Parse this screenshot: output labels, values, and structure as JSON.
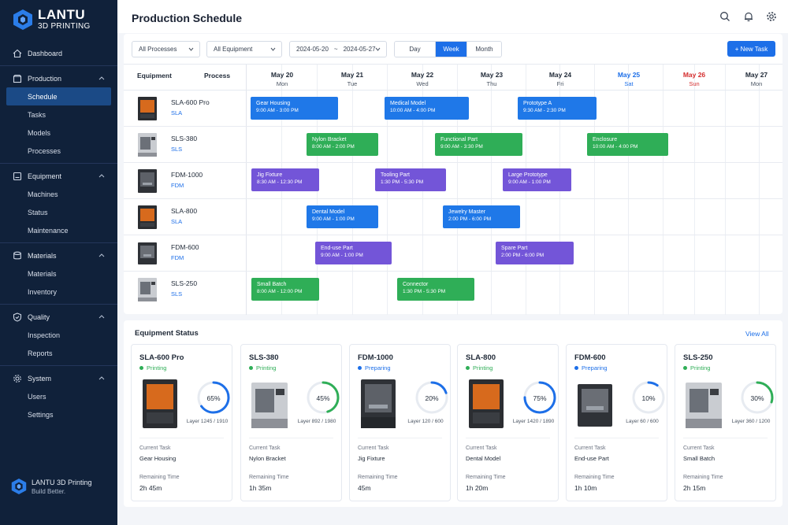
{
  "brand": {
    "name": "LANTU",
    "sub": "3D PRINTING"
  },
  "nav": {
    "dashboard": "Dashboard",
    "production": "Production",
    "schedule": "Schedule",
    "tasks": "Tasks",
    "models": "Models",
    "processes": "Processes",
    "equipment": "Equipment",
    "machines": "Machines",
    "status": "Status",
    "maintenance": "Maintenance",
    "materials": "Materials",
    "materials_sub": "Materials",
    "inventory": "Inventory",
    "quality": "Quality",
    "inspection": "Inspection",
    "reports": "Reports",
    "system": "System",
    "users": "Users",
    "settings": "Settings"
  },
  "footer": {
    "name": "LANTU 3D Printing",
    "tagline": "Build Better."
  },
  "header": {
    "title": "Production Schedule"
  },
  "filters": {
    "process": "All Processes",
    "equipment": "All Equipment",
    "date_from": "2024-05-20",
    "date_sep": "~",
    "date_to": "2024-05-27",
    "view_day": "Day",
    "view_week": "Week",
    "view_month": "Month",
    "new_task": "+ New Task"
  },
  "grid": {
    "col_equipment": "Equipment",
    "col_process": "Process",
    "days": [
      {
        "date": "May 20",
        "weekday": "Mon"
      },
      {
        "date": "May 21",
        "weekday": "Tue"
      },
      {
        "date": "May 22",
        "weekday": "Wed"
      },
      {
        "date": "May 23",
        "weekday": "Thu"
      },
      {
        "date": "May 24",
        "weekday": "Fri"
      },
      {
        "date": "May 25",
        "weekday": "Sat"
      },
      {
        "date": "May 26",
        "weekday": "Sun"
      },
      {
        "date": "May 27",
        "weekday": "Mon"
      }
    ],
    "rows": [
      {
        "name": "SLA-600 Pro",
        "process": "SLA",
        "tasks": [
          {
            "name": "Gear Housing",
            "time": "9:00 AM - 3:00 PM"
          },
          {
            "name": "Medical Model",
            "time": "10:00 AM - 4:00 PM"
          },
          {
            "name": "Prototype A",
            "time": "9:30 AM - 2:30 PM"
          }
        ]
      },
      {
        "name": "SLS-380",
        "process": "SLS",
        "tasks": [
          {
            "name": "Nylon Bracket",
            "time": "8:00 AM - 2:00 PM"
          },
          {
            "name": "Functional Part",
            "time": "9:00 AM - 3:30 PM"
          },
          {
            "name": "Enclosure",
            "time": "10:00 AM - 4:00 PM"
          }
        ]
      },
      {
        "name": "FDM-1000",
        "process": "FDM",
        "tasks": [
          {
            "name": "Jig Fixture",
            "time": "8:30 AM - 12:30 PM"
          },
          {
            "name": "Tooling Part",
            "time": "1:30 PM - 5:30 PM"
          },
          {
            "name": "Large Prototype",
            "time": "9:00 AM - 1:00 PM"
          }
        ]
      },
      {
        "name": "SLA-800",
        "process": "SLA",
        "tasks": [
          {
            "name": "Dental Model",
            "time": "9:00 AM - 1:00 PM"
          },
          {
            "name": "Jewelry Master",
            "time": "2:00 PM - 6:00 PM"
          }
        ]
      },
      {
        "name": "FDM-600",
        "process": "FDM",
        "tasks": [
          {
            "name": "End-use Part",
            "time": "9:00 AM - 1:00 PM"
          },
          {
            "name": "Spare Part",
            "time": "2:00 PM - 6:00 PM"
          }
        ]
      },
      {
        "name": "SLS-250",
        "process": "SLS",
        "tasks": [
          {
            "name": "Small Batch",
            "time": "8:00 AM - 12:00 PM"
          },
          {
            "name": "Connector",
            "time": "1:30 PM - 5:30 PM"
          }
        ]
      }
    ]
  },
  "equipment_status": {
    "title": "Equipment Status",
    "view_all": "View All",
    "current_task_label": "Current Task",
    "remaining_label": "Remaining Time",
    "cards": [
      {
        "name": "SLA-600 Pro",
        "status": "Printing",
        "progress": "65%",
        "progress_value": 0.65,
        "layer": "Layer 1245 / 1910",
        "task": "Gear Housing",
        "remaining": "2h 45m"
      },
      {
        "name": "SLS-380",
        "status": "Printing",
        "progress": "45%",
        "progress_value": 0.45,
        "layer": "Layer 892 / 1980",
        "task": "Nylon Bracket",
        "remaining": "1h 35m"
      },
      {
        "name": "FDM-1000",
        "status": "Preparing",
        "progress": "20%",
        "progress_value": 0.2,
        "layer": "Layer 120 / 600",
        "task": "Jig Fixture",
        "remaining": "45m"
      },
      {
        "name": "SLA-800",
        "status": "Printing",
        "progress": "75%",
        "progress_value": 0.75,
        "layer": "Layer 1420 / 1890",
        "task": "Dental Model",
        "remaining": "1h 20m"
      },
      {
        "name": "FDM-600",
        "status": "Preparing",
        "progress": "10%",
        "progress_value": 0.1,
        "layer": "Layer 60 / 600",
        "task": "End-use Part",
        "remaining": "1h 10m"
      },
      {
        "name": "SLS-250",
        "status": "Printing",
        "progress": "30%",
        "progress_value": 0.3,
        "layer": "Layer 360 / 1200",
        "task": "Small Batch",
        "remaining": "2h 15m"
      }
    ]
  },
  "colors": {
    "accent": "#1d6fe8",
    "printing": "#2fae57",
    "preparing": "#1d6fe8",
    "sidebar": "#10213a",
    "task_blue": "#1f78e8",
    "task_green": "#2fae57",
    "task_purple": "#7355d8"
  }
}
